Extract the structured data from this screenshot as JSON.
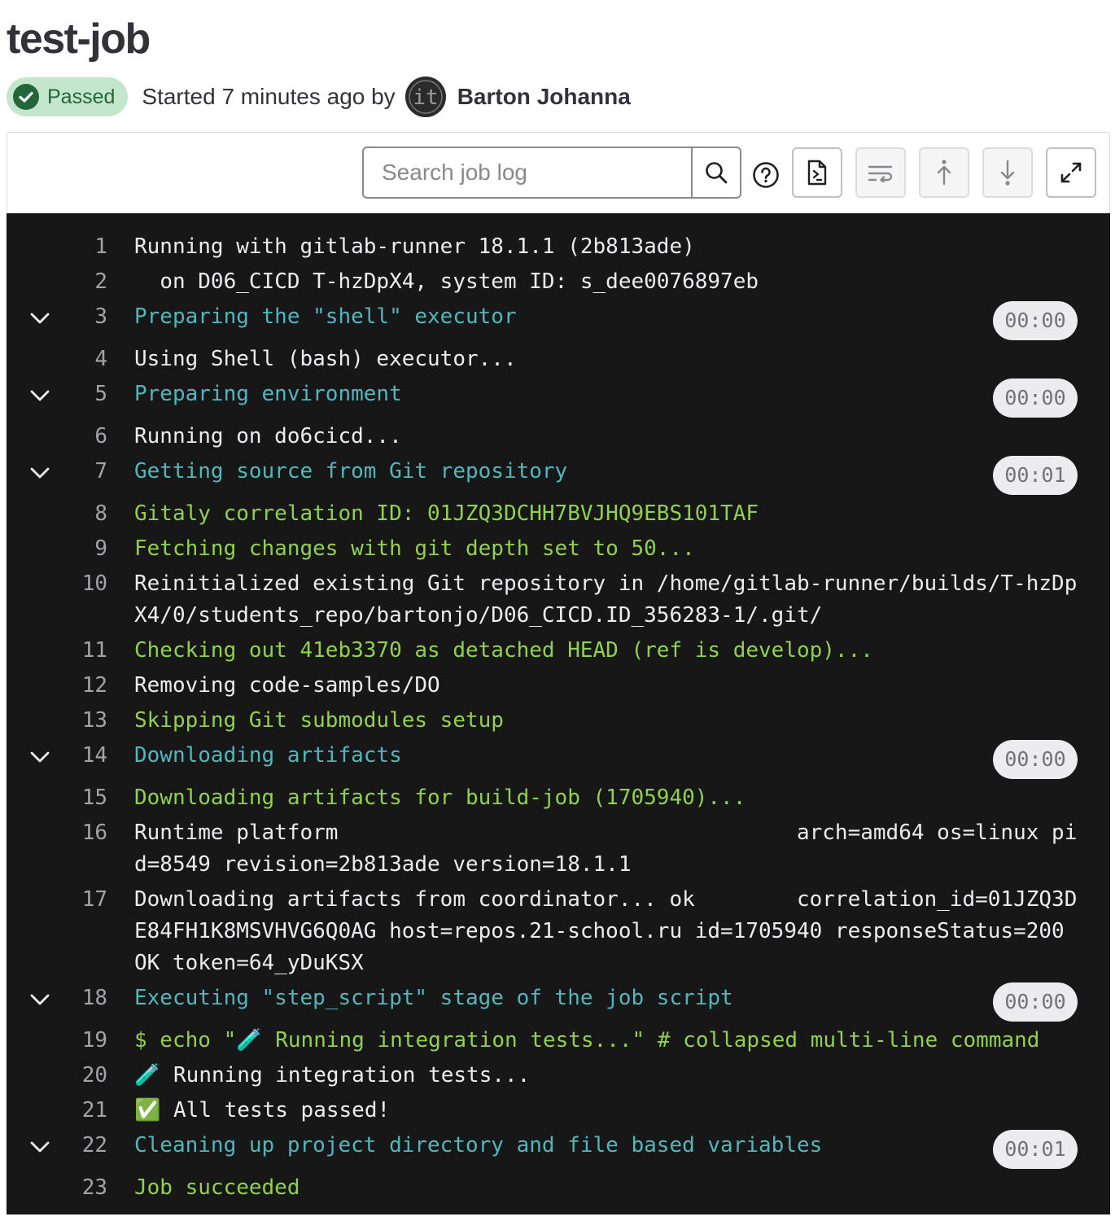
{
  "job": {
    "title": "test-job",
    "status": "Passed",
    "started_text": "Started 7 minutes ago by",
    "author": "Barton Johanna",
    "avatar_text": "it"
  },
  "toolbar": {
    "search_placeholder": "Search job log",
    "icons": [
      "search-icon",
      "help-icon",
      "raw-log-icon",
      "wrap-lines-icon",
      "scroll-top-icon",
      "scroll-bottom-icon",
      "fullscreen-icon"
    ]
  },
  "colors": {
    "status_bg": "#c3e6cd",
    "status_text": "#24663b",
    "log_bg": "#171717",
    "section_text": "#52b7bd",
    "success_text": "#91d14d",
    "plain_text": "#ececef"
  },
  "log": [
    {
      "n": "1",
      "text": "Running with gitlab-runner 18.1.1 (2b813ade)",
      "style": "plain"
    },
    {
      "n": "2",
      "text": "  on D06_CICD T-hzDpX4, system ID: s_dee0076897eb",
      "style": "plain"
    },
    {
      "n": "3",
      "text": "Preparing the \"shell\" executor",
      "style": "sec",
      "duration": "00:00"
    },
    {
      "n": "4",
      "text": "Using Shell (bash) executor...",
      "style": "plain"
    },
    {
      "n": "5",
      "text": "Preparing environment",
      "style": "sec",
      "duration": "00:00"
    },
    {
      "n": "6",
      "text": "Running on do6cicd...",
      "style": "plain"
    },
    {
      "n": "7",
      "text": "Getting source from Git repository",
      "style": "sec",
      "duration": "00:01"
    },
    {
      "n": "8",
      "text": "Gitaly correlation ID: 01JZQ3DCHH7BVJHQ9EBS101TAF",
      "style": "ok"
    },
    {
      "n": "9",
      "text": "Fetching changes with git depth set to 50...",
      "style": "ok"
    },
    {
      "n": "10",
      "text": "Reinitialized existing Git repository in /home/gitlab-runner/builds/T-hzDpX4/0/students_repo/bartonjo/D06_CICD.ID_356283-1/.git/",
      "style": "plain"
    },
    {
      "n": "11",
      "text": "Checking out 41eb3370 as detached HEAD (ref is develop)...",
      "style": "ok"
    },
    {
      "n": "12",
      "text": "Removing code-samples/DO",
      "style": "plain"
    },
    {
      "n": "13",
      "text": "Skipping Git submodules setup",
      "style": "ok"
    },
    {
      "n": "14",
      "text": "Downloading artifacts",
      "style": "sec",
      "duration": "00:00"
    },
    {
      "n": "15",
      "text": "Downloading artifacts for build-job (1705940)...",
      "style": "ok"
    },
    {
      "n": "16",
      "text": "Runtime platform                                    arch=amd64 os=linux pid=8549 revision=2b813ade version=18.1.1",
      "style": "plain"
    },
    {
      "n": "17",
      "text": "Downloading artifacts from coordinator... ok        correlation_id=01JZQ3DE84FH1K8MSVHVG6Q0AG host=repos.21-school.ru id=1705940 responseStatus=200 OK token=64_yDuKSX",
      "style": "plain"
    },
    {
      "n": "18",
      "text": "Executing \"step_script\" stage of the job script",
      "style": "sec",
      "duration": "00:00"
    },
    {
      "n": "19",
      "text": "$ echo \"🧪 Running integration tests...\" # collapsed multi-line command",
      "style": "ok"
    },
    {
      "n": "20",
      "text": "🧪 Running integration tests...",
      "style": "plain"
    },
    {
      "n": "21",
      "text": "✅ All tests passed!",
      "style": "plain"
    },
    {
      "n": "22",
      "text": "Cleaning up project directory and file based variables",
      "style": "sec",
      "duration": "00:01"
    },
    {
      "n": "23",
      "text": "Job succeeded",
      "style": "ok"
    }
  ]
}
